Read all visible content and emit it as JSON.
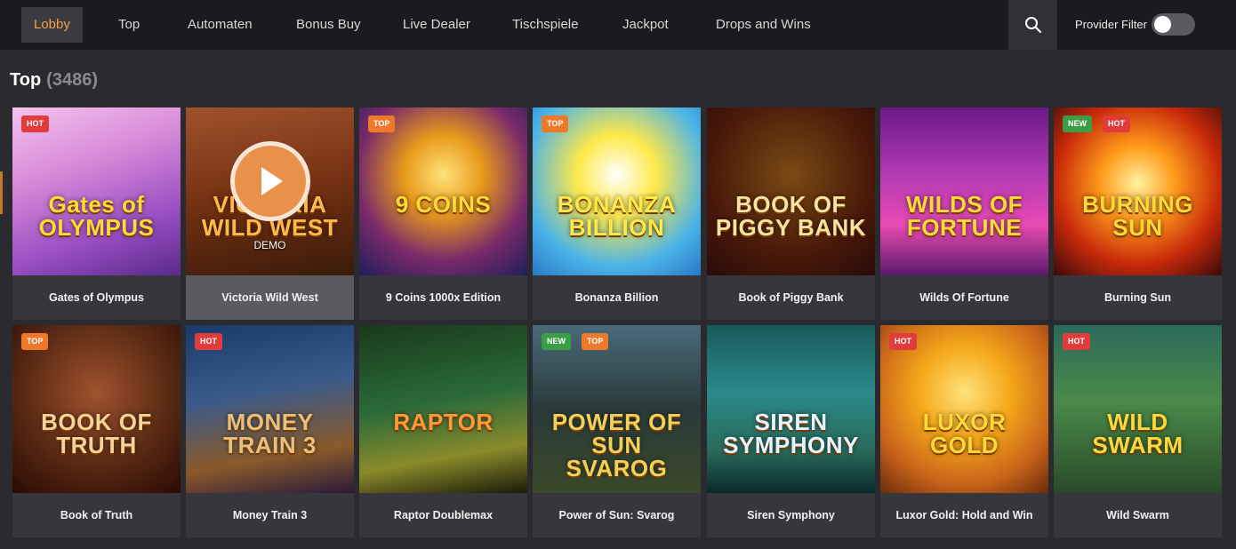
{
  "nav": {
    "items": [
      {
        "label": "Lobby",
        "active": true
      },
      {
        "label": "Top"
      },
      {
        "label": "Automaten"
      },
      {
        "label": "Bonus Buy"
      },
      {
        "label": "Live Dealer"
      },
      {
        "label": "Tischspiele"
      },
      {
        "label": "Jackpot"
      },
      {
        "label": "Drops and Wins"
      }
    ],
    "search_icon": "search-icon",
    "provider_filter_label": "Provider Filter",
    "provider_filter_on": false
  },
  "section": {
    "title": "Top",
    "count": "(3486)"
  },
  "colors": {
    "accent": "#f0a24a",
    "hot": "#e23b3b",
    "top": "#ec7a2a",
    "new": "#3a9e45"
  },
  "games": [
    {
      "name": "Gates of Olympus",
      "logo": "Gates of OLYMPUS",
      "badges": [
        "HOT"
      ]
    },
    {
      "name": "Victoria Wild West",
      "logo": "VICTORIA WILD WEST",
      "badges": [],
      "hover": true,
      "demo_label": "DEMO"
    },
    {
      "name": "9 Coins 1000x Edition",
      "logo": "9 COINS",
      "badges": [
        "TOP"
      ]
    },
    {
      "name": "Bonanza Billion",
      "logo": "BONANZA BILLION",
      "badges": [
        "TOP"
      ]
    },
    {
      "name": "Book of Piggy Bank",
      "logo": "BOOK OF PIGGY BANK",
      "badges": []
    },
    {
      "name": "Wilds Of Fortune",
      "logo": "WILDS OF FORTUNE",
      "badges": []
    },
    {
      "name": "Burning Sun",
      "logo": "BURNING SUN",
      "badges": [
        "NEW",
        "HOT"
      ]
    },
    {
      "name": "Book of Truth",
      "logo": "BOOK OF TRUTH",
      "badges": [
        "TOP"
      ]
    },
    {
      "name": "Money Train 3",
      "logo": "MONEY TRAIN 3",
      "badges": [
        "HOT"
      ]
    },
    {
      "name": "Raptor Doublemax",
      "logo": "RAPTOR",
      "badges": []
    },
    {
      "name": "Power of Sun: Svarog",
      "logo": "POWER OF SUN SVAROG",
      "badges": [
        "NEW",
        "TOP"
      ]
    },
    {
      "name": "Siren Symphony",
      "logo": "SIREN SYMPHONY",
      "badges": []
    },
    {
      "name": "Luxor Gold: Hold and Win",
      "logo": "LUXOR GOLD",
      "badges": [
        "HOT"
      ]
    },
    {
      "name": "Wild Swarm",
      "logo": "WILD SWARM",
      "badges": [
        "HOT"
      ]
    }
  ]
}
